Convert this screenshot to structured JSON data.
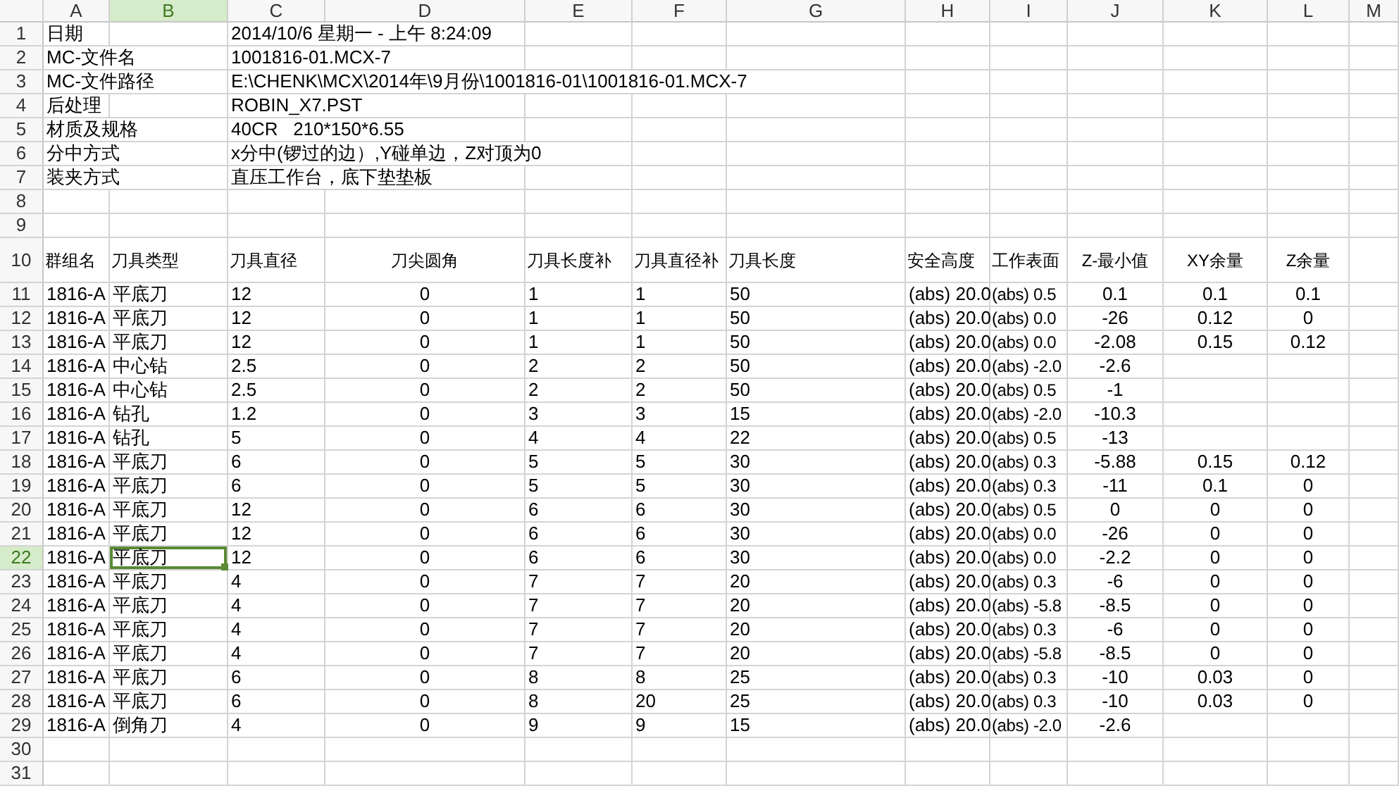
{
  "column_headers": [
    {
      "label": "A",
      "selected": false
    },
    {
      "label": "B",
      "selected": true
    },
    {
      "label": "C",
      "selected": false
    },
    {
      "label": "D",
      "selected": false
    },
    {
      "label": "E",
      "selected": false
    },
    {
      "label": "F",
      "selected": false
    },
    {
      "label": "G",
      "selected": false
    },
    {
      "label": "H",
      "selected": false
    },
    {
      "label": "I",
      "selected": false
    },
    {
      "label": "J",
      "selected": false
    },
    {
      "label": "K",
      "selected": false
    },
    {
      "label": "L",
      "selected": false
    },
    {
      "label": "M",
      "selected": false
    }
  ],
  "rows": [
    {
      "number": "1",
      "kind": "data",
      "selected": false,
      "cells": {
        "a": "日期",
        "c": "2014/10/6 星期一 - 上午 8:24:09"
      }
    },
    {
      "number": "2",
      "kind": "data",
      "selected": false,
      "cells": {
        "a": "MC-文件名",
        "c": "1001816-01.MCX-7"
      }
    },
    {
      "number": "3",
      "kind": "data",
      "selected": false,
      "cells": {
        "a": "MC-文件路径",
        "c": "E:\\CHENK\\MCX\\2014年\\9月份\\1001816-01\\1001816-01.MCX-7"
      }
    },
    {
      "number": "4",
      "kind": "data",
      "selected": false,
      "cells": {
        "a": "后处理",
        "c": "ROBIN_X7.PST"
      }
    },
    {
      "number": "5",
      "kind": "data",
      "selected": false,
      "cells": {
        "a": "材质及规格",
        "c": "40CR   210*150*6.55"
      }
    },
    {
      "number": "6",
      "kind": "data",
      "selected": false,
      "cells": {
        "a": "分中方式",
        "c": "x分中(锣过的边）,Y碰单边，Z对顶为0"
      }
    },
    {
      "number": "7",
      "kind": "data",
      "selected": false,
      "cells": {
        "a": "装夹方式",
        "c": "直压工作台，底下垫垫板"
      }
    },
    {
      "number": "8",
      "kind": "data",
      "selected": false
    },
    {
      "number": "9",
      "kind": "data",
      "selected": false
    },
    {
      "number": "10",
      "kind": "header",
      "selected": false,
      "cells": {
        "a": "群组名",
        "b": "刀具类型",
        "c": "刀具直径",
        "d": "刀尖圆角",
        "e": "刀具长度补",
        "f": "刀具直径补",
        "g": "刀具长度",
        "h": "安全高度",
        "i": "工作表面",
        "j": "Z-最小值",
        "k": "XY余量",
        "l": "Z余量"
      }
    },
    {
      "number": "11",
      "kind": "data",
      "selected": false,
      "cells": {
        "a": "1816-A",
        "b": "平底刀",
        "c": "12",
        "d": "0",
        "e": "1",
        "f": "1",
        "g": "50",
        "h": "(abs) 20.0",
        "i": "(abs) 0.5",
        "j": "0.1",
        "k": "0.1",
        "l": "0.1"
      }
    },
    {
      "number": "12",
      "kind": "data",
      "selected": false,
      "cells": {
        "a": "1816-A",
        "b": "平底刀",
        "c": "12",
        "d": "0",
        "e": "1",
        "f": "1",
        "g": "50",
        "h": "(abs) 20.0",
        "i": "(abs) 0.0",
        "j": "-26",
        "k": "0.12",
        "l": "0"
      }
    },
    {
      "number": "13",
      "kind": "data",
      "selected": false,
      "cells": {
        "a": "1816-A",
        "b": "平底刀",
        "c": "12",
        "d": "0",
        "e": "1",
        "f": "1",
        "g": "50",
        "h": "(abs) 20.0",
        "i": "(abs) 0.0",
        "j": "-2.08",
        "k": "0.15",
        "l": "0.12"
      }
    },
    {
      "number": "14",
      "kind": "data",
      "selected": false,
      "cells": {
        "a": "1816-A",
        "b": "中心钻",
        "c": "2.5",
        "d": "0",
        "e": "2",
        "f": "2",
        "g": "50",
        "h": "(abs) 20.0",
        "i": "(abs) -2.0",
        "j": "-2.6"
      }
    },
    {
      "number": "15",
      "kind": "data",
      "selected": false,
      "cells": {
        "a": "1816-A",
        "b": "中心钻",
        "c": "2.5",
        "d": "0",
        "e": "2",
        "f": "2",
        "g": "50",
        "h": "(abs) 20.0",
        "i": "(abs) 0.5",
        "j": "-1"
      }
    },
    {
      "number": "16",
      "kind": "data",
      "selected": false,
      "cells": {
        "a": "1816-A",
        "b": "钻孔",
        "c": "1.2",
        "d": "0",
        "e": "3",
        "f": "3",
        "g": "15",
        "h": "(abs) 20.0",
        "i": "(abs) -2.0",
        "j": "-10.3"
      }
    },
    {
      "number": "17",
      "kind": "data",
      "selected": false,
      "cells": {
        "a": "1816-A",
        "b": "钻孔",
        "c": "5",
        "d": "0",
        "e": "4",
        "f": "4",
        "g": "22",
        "h": "(abs) 20.0",
        "i": "(abs) 0.5",
        "j": "-13"
      }
    },
    {
      "number": "18",
      "kind": "data",
      "selected": false,
      "cells": {
        "a": "1816-A",
        "b": "平底刀",
        "c": "6",
        "d": "0",
        "e": "5",
        "f": "5",
        "g": "30",
        "h": "(abs) 20.0",
        "i": "(abs) 0.3",
        "j": "-5.88",
        "k": "0.15",
        "l": "0.12"
      }
    },
    {
      "number": "19",
      "kind": "data",
      "selected": false,
      "cells": {
        "a": "1816-A",
        "b": "平底刀",
        "c": "6",
        "d": "0",
        "e": "5",
        "f": "5",
        "g": "30",
        "h": "(abs) 20.0",
        "i": "(abs) 0.3",
        "j": "-11",
        "k": "0.1",
        "l": "0"
      }
    },
    {
      "number": "20",
      "kind": "data",
      "selected": false,
      "cells": {
        "a": "1816-A",
        "b": "平底刀",
        "c": "12",
        "d": "0",
        "e": "6",
        "f": "6",
        "g": "30",
        "h": "(abs) 20.0",
        "i": "(abs) 0.5",
        "j": "0",
        "k": "0",
        "l": "0"
      }
    },
    {
      "number": "21",
      "kind": "data",
      "selected": false,
      "cells": {
        "a": "1816-A",
        "b": "平底刀",
        "c": "12",
        "d": "0",
        "e": "6",
        "f": "6",
        "g": "30",
        "h": "(abs) 20.0",
        "i": "(abs) 0.0",
        "j": "-26",
        "k": "0",
        "l": "0"
      }
    },
    {
      "number": "22",
      "kind": "data",
      "selected": true,
      "cells": {
        "a": "1816-A",
        "b": "平底刀",
        "c": "12",
        "d": "0",
        "e": "6",
        "f": "6",
        "g": "30",
        "h": "(abs) 20.0",
        "i": "(abs) 0.0",
        "j": "-2.2",
        "k": "0",
        "l": "0"
      }
    },
    {
      "number": "23",
      "kind": "data",
      "selected": false,
      "cells": {
        "a": "1816-A",
        "b": "平底刀",
        "c": "4",
        "d": "0",
        "e": "7",
        "f": "7",
        "g": "20",
        "h": "(abs) 20.0",
        "i": "(abs) 0.3",
        "j": "-6",
        "k": "0",
        "l": "0"
      }
    },
    {
      "number": "24",
      "kind": "data",
      "selected": false,
      "cells": {
        "a": "1816-A",
        "b": "平底刀",
        "c": "4",
        "d": "0",
        "e": "7",
        "f": "7",
        "g": "20",
        "h": "(abs) 20.0",
        "i": "(abs) -5.8",
        "j": "-8.5",
        "k": "0",
        "l": "0"
      }
    },
    {
      "number": "25",
      "kind": "data",
      "selected": false,
      "cells": {
        "a": "1816-A",
        "b": "平底刀",
        "c": "4",
        "d": "0",
        "e": "7",
        "f": "7",
        "g": "20",
        "h": "(abs) 20.0",
        "i": "(abs) 0.3",
        "j": "-6",
        "k": "0",
        "l": "0"
      }
    },
    {
      "number": "26",
      "kind": "data",
      "selected": false,
      "cells": {
        "a": "1816-A",
        "b": "平底刀",
        "c": "4",
        "d": "0",
        "e": "7",
        "f": "7",
        "g": "20",
        "h": "(abs) 20.0",
        "i": "(abs) -5.8",
        "j": "-8.5",
        "k": "0",
        "l": "0"
      }
    },
    {
      "number": "27",
      "kind": "data",
      "selected": false,
      "cells": {
        "a": "1816-A",
        "b": "平底刀",
        "c": "6",
        "d": "0",
        "e": "8",
        "f": "8",
        "g": "25",
        "h": "(abs) 20.0",
        "i": "(abs) 0.3",
        "j": "-10",
        "k": "0.03",
        "l": "0"
      }
    },
    {
      "number": "28",
      "kind": "data",
      "selected": false,
      "cells": {
        "a": "1816-A",
        "b": "平底刀",
        "c": "6",
        "d": "0",
        "e": "8",
        "f": "20",
        "g": "25",
        "h": "(abs) 20.0",
        "i": "(abs) 0.3",
        "j": "-10",
        "k": "0.03",
        "l": "0"
      }
    },
    {
      "number": "29",
      "kind": "data",
      "selected": false,
      "cells": {
        "a": "1816-A",
        "b": "倒角刀",
        "c": "4",
        "d": "0",
        "e": "9",
        "f": "9",
        "g": "15",
        "h": "(abs) 20.0",
        "i": "(abs) -2.0",
        "j": "-2.6"
      }
    },
    {
      "number": "30",
      "kind": "data",
      "selected": false
    },
    {
      "number": "31",
      "kind": "data",
      "selected": false
    }
  ]
}
